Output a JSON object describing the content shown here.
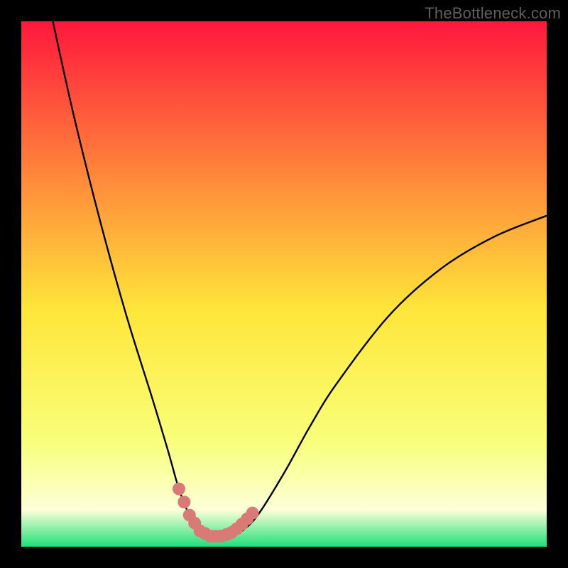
{
  "watermark": "TheBottleneck.com",
  "colors": {
    "black": "#000000",
    "curve": "#000000",
    "marker": "#d97a77",
    "grad_top": "#ff173d",
    "grad_mid_upper": "#ff8a3a",
    "grad_mid": "#ffe63a",
    "grad_lower": "#f8ff7a",
    "grad_cream": "#fdffd8",
    "grad_green": "#1fe07a"
  },
  "chart_data": {
    "type": "line",
    "title": "",
    "xlabel": "",
    "ylabel": "",
    "xlim": [
      0,
      100
    ],
    "ylim": [
      0,
      100
    ],
    "series": [
      {
        "name": "bottleneck-curve",
        "x": [
          6,
          10,
          15,
          20,
          25,
          28,
          30,
          32,
          34,
          36,
          38,
          40,
          42,
          45,
          50,
          55,
          60,
          70,
          80,
          90,
          100
        ],
        "y": [
          100,
          82,
          62,
          44,
          28,
          18,
          11,
          6,
          3,
          2,
          2,
          2,
          3,
          6,
          14,
          23,
          31,
          44,
          53,
          59,
          63
        ]
      }
    ],
    "markers": {
      "name": "highlight-band",
      "x": [
        30,
        31,
        32,
        33,
        34,
        35,
        36,
        37,
        38,
        39,
        40,
        41,
        42,
        43,
        44
      ],
      "y": [
        11,
        8.5,
        6,
        4.5,
        3,
        2.5,
        2,
        2,
        2,
        2.3,
        2.7,
        3.4,
        4.3,
        5.3,
        6.4
      ]
    }
  }
}
